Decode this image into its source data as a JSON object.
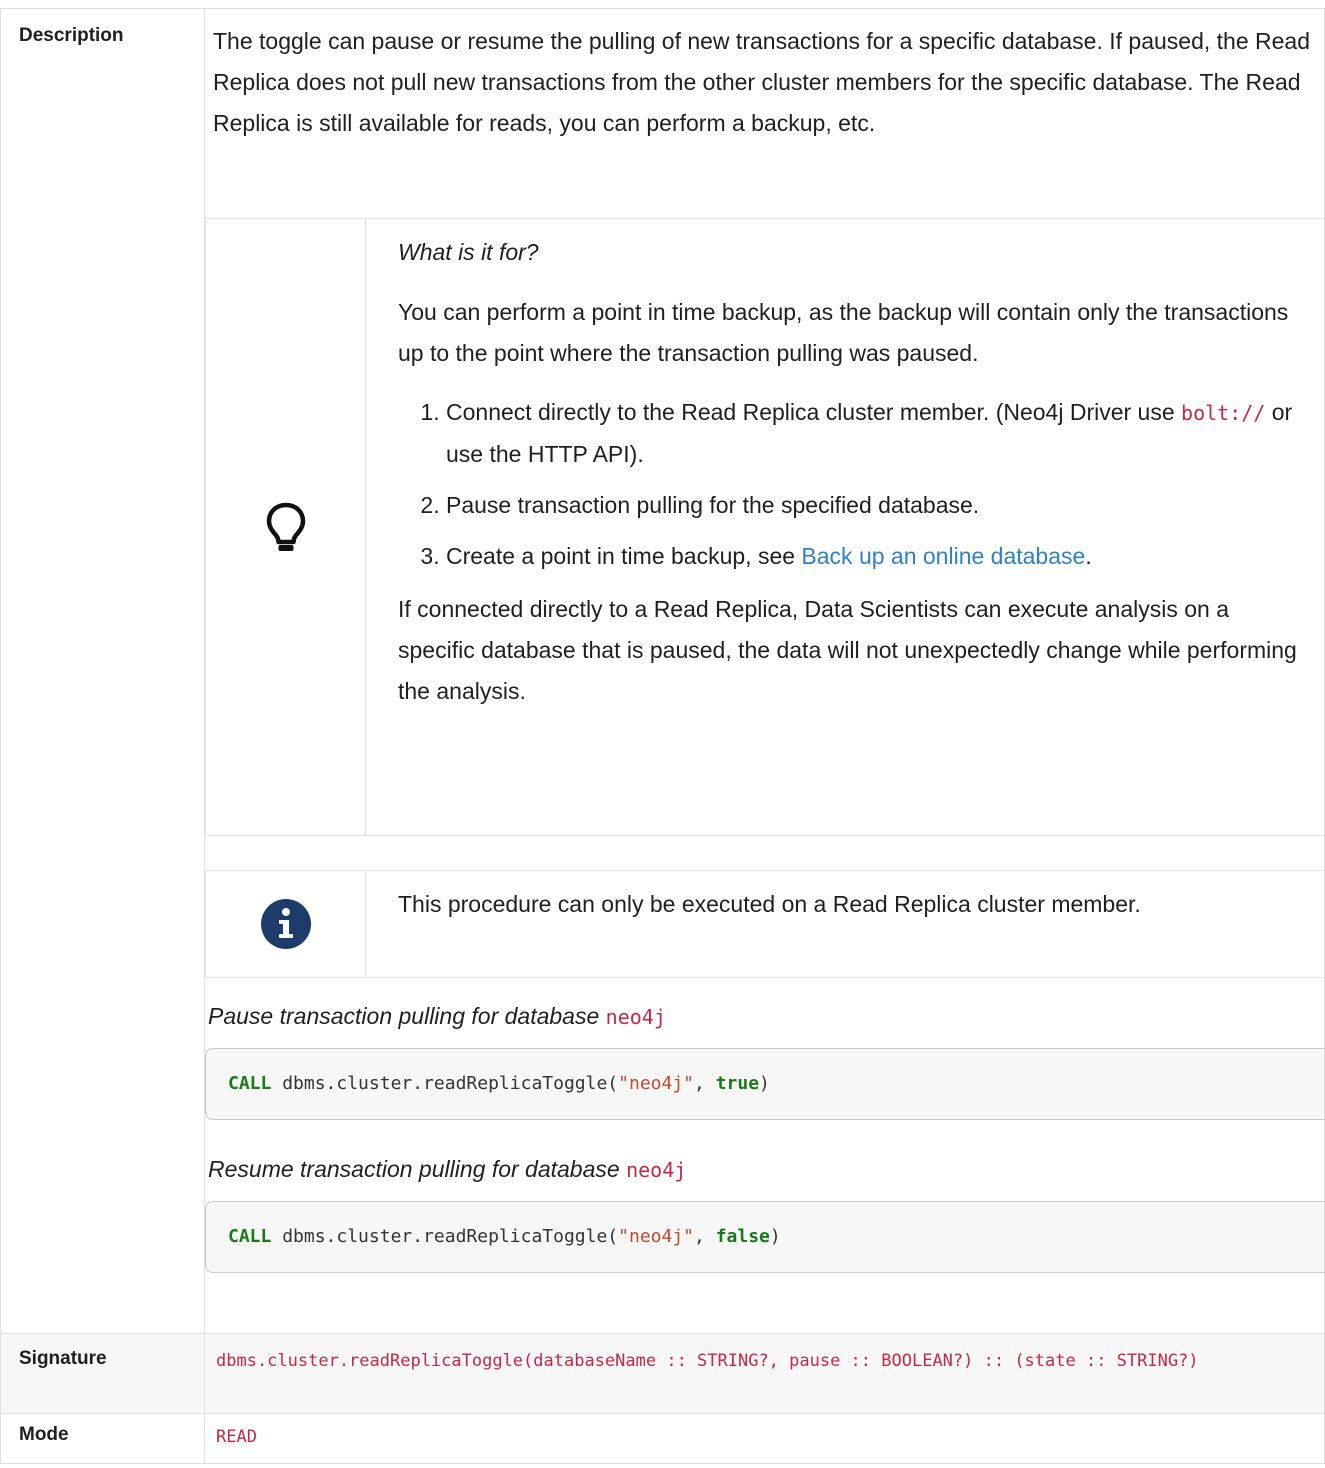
{
  "rows": {
    "description_label": "Description",
    "signature_label": "Signature",
    "mode_label": "Mode"
  },
  "description": {
    "intro": "The toggle can pause or resume the pulling of new transactions for a specific database. If paused, the Read Replica does not pull new transactions from the other cluster members for the specific database. The Read Replica is still available for reads, you can perform a backup, etc.",
    "tip": {
      "icon": "lightbulb-icon",
      "title": "What is it for?",
      "para1": "You can perform a point in time backup, as the backup will contain only the transactions up to the point where the transaction pulling was paused.",
      "step1_a": "Connect directly to the Read Replica cluster member. (Neo4j Driver use ",
      "step1_code": "bolt://",
      "step1_b": " or use the HTTP API).",
      "step2": "Pause transaction pulling for the specified database.",
      "step3_a": "Create a point in time backup, see ",
      "step3_link": "Back up an online database",
      "step3_b": ".",
      "para2": "If connected directly to a Read Replica, Data Scientists can execute analysis on a specific database that is paused, the data will not unexpectedly change while performing the analysis."
    },
    "note": {
      "icon": "info-circle-icon",
      "text": "This procedure can only be executed on a Read Replica cluster member."
    },
    "examples": [
      {
        "caption": "Pause transaction pulling for database ",
        "caption_code": "neo4j",
        "kw": "CALL",
        "fn": " dbms.cluster.readReplicaToggle(",
        "arg": "\"neo4j\"",
        "sep": ", ",
        "bool": "true",
        "close": ")"
      },
      {
        "caption": "Resume transaction pulling for database ",
        "caption_code": "neo4j",
        "kw": "CALL",
        "fn": " dbms.cluster.readReplicaToggle(",
        "arg": "\"neo4j\"",
        "sep": ", ",
        "bool": "false",
        "close": ")"
      }
    ]
  },
  "signature": "dbms.cluster.readReplicaToggle(databaseName :: STRING?, pause :: BOOLEAN?) :: (state :: STRING?)",
  "mode": "READ",
  "colors": {
    "code_pink": "#c02a48",
    "keyword_green": "#1a7a1a",
    "string_orange": "#c44a2c",
    "link_blue": "#2f81c4",
    "info_navy": "#1d3b6b"
  }
}
